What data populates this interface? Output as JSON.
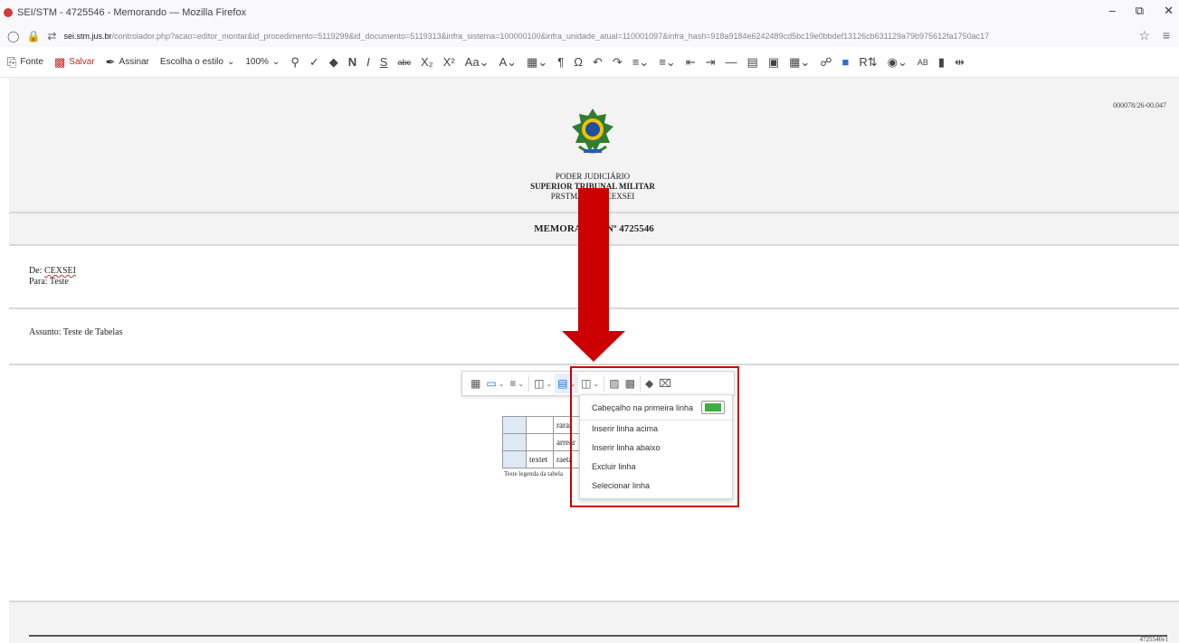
{
  "browser": {
    "title": "SEI/STM - 4725546 - Memorando — Mozilla Firefox",
    "url_host": "sei.stm.jus.br",
    "url_path": "/controlador.php?acao=editor_montar&id_procedimento=5119299&id_documento=5119313&infra_sistema=100000100&infra_unidade_atual=110001097&infra_hash=918a9184e6242489cd5bc19e0bbdef13126cb631129a79b975612fa1750ac17"
  },
  "toolbar": {
    "fonte": "Fonte",
    "salvar": "Salvar",
    "assinar": "Assinar",
    "estilo": "Escolha o estilo",
    "zoom": "100%"
  },
  "document": {
    "code": "000078/26-00.047",
    "org_line1": "PODER JUDICIÁRIO",
    "org_line2": "SUPERIOR TRIBUNAL MILITAR",
    "org_line3": "PRSTM/DIGEP/CEXSEI",
    "memo_title": "MEMORANDO Nº 4725546",
    "de_label": "De:",
    "de_value": "CEXSEI",
    "para_label": "Para:",
    "para_value": "Teste",
    "assunto": "Assunto: Teste de Tabelas",
    "footer_code": "4725546v1"
  },
  "table": {
    "rows": [
      [
        "",
        "",
        "rarar"
      ],
      [
        "",
        "",
        "arrear"
      ],
      [
        "",
        "textet",
        "raeta"
      ]
    ],
    "caption": "Teste legenda da tabela"
  },
  "dropdown": {
    "header_toggle_label": "Cabeçalho na primeira linha",
    "header_toggle_on": true,
    "items": [
      "Inserir linha acima",
      "Inserir linha abaixo",
      "Excluir linha",
      "Selecionar linha"
    ]
  },
  "annotation": {
    "color": "#cc0000"
  }
}
